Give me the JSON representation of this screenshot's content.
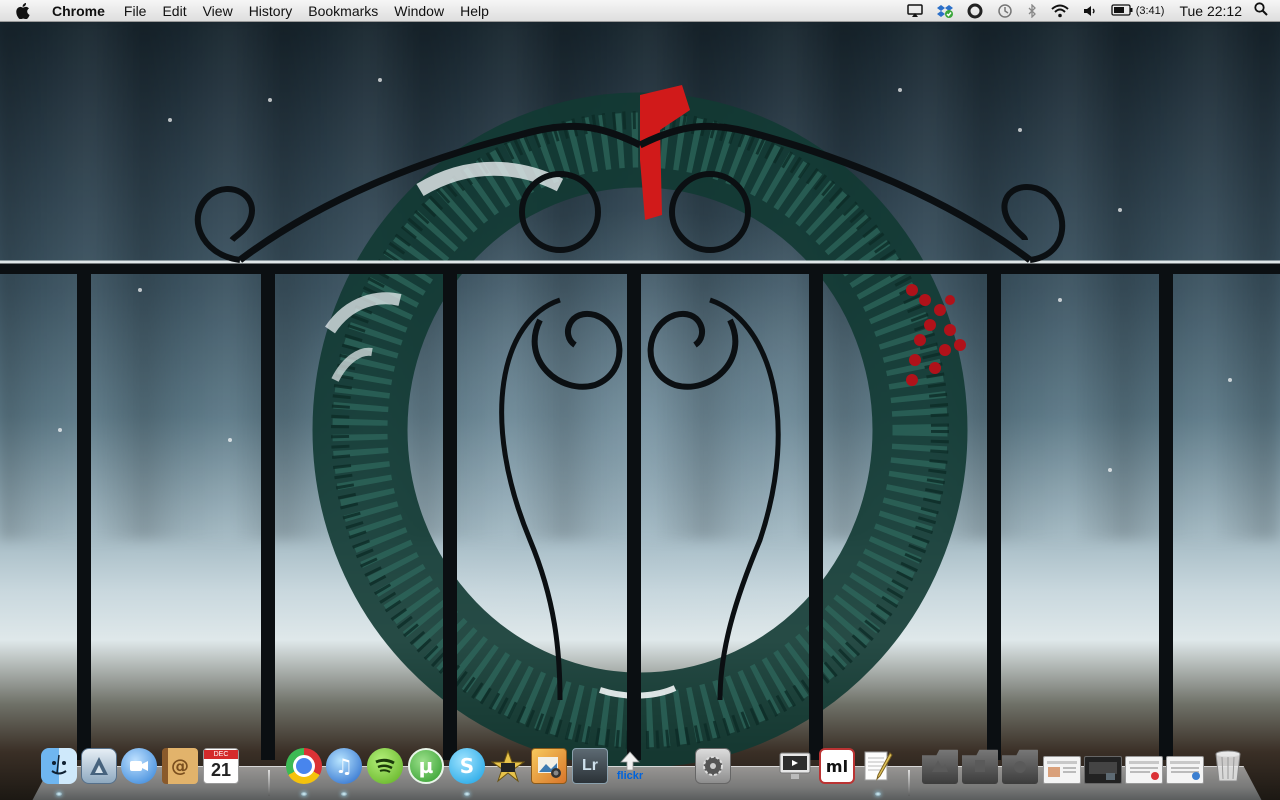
{
  "menubar": {
    "apple_icon": "apple-icon",
    "app_name": "Chrome",
    "menus": [
      "File",
      "Edit",
      "View",
      "History",
      "Bookmarks",
      "Window",
      "Help"
    ],
    "status_icons": [
      "airplay-icon",
      "dropbox-icon",
      "circle-app-icon",
      "time-machine-icon",
      "bluetooth-icon",
      "wifi-icon",
      "volume-icon"
    ],
    "battery": {
      "icon": "battery-icon",
      "text": "(3:41)"
    },
    "clock": "Tue 22:12",
    "search_icon": "spotlight-icon"
  },
  "dock": {
    "apps": [
      {
        "name": "Finder",
        "icon": "finder-icon",
        "running": true
      },
      {
        "name": "Mail",
        "icon": "mail-icon",
        "running": false
      },
      {
        "name": "iChat",
        "icon": "ichat-icon",
        "running": false
      },
      {
        "name": "Address Book",
        "icon": "address-book-icon",
        "running": false
      },
      {
        "name": "iCal",
        "icon": "ical-icon",
        "running": false,
        "label_top": "DEC",
        "label": "21"
      },
      {
        "name": "Chrome",
        "icon": "chrome-icon",
        "running": true
      },
      {
        "name": "iTunes",
        "icon": "itunes-icon",
        "running": true
      },
      {
        "name": "Spotify",
        "icon": "spotify-icon",
        "running": false
      },
      {
        "name": "uTorrent",
        "icon": "utorrent-icon",
        "running": false
      },
      {
        "name": "Skype",
        "icon": "skype-icon",
        "running": true
      },
      {
        "name": "iMovie",
        "icon": "imovie-icon",
        "running": false
      },
      {
        "name": "iPhoto",
        "icon": "iphoto-icon",
        "running": false
      },
      {
        "name": "Lightroom",
        "icon": "lightroom-icon",
        "running": false,
        "label": "Lr"
      },
      {
        "name": "Flickr Uploadr",
        "icon": "flickr-icon",
        "running": false,
        "label": "flickr"
      },
      {
        "name": "System Preferences",
        "icon": "system-preferences-icon",
        "running": false
      },
      {
        "name": "Front Row",
        "icon": "front-row-icon",
        "running": false
      },
      {
        "name": "MarsEdit",
        "icon": "marsedit-icon",
        "running": false,
        "label": "ml"
      },
      {
        "name": "TextEdit",
        "icon": "textedit-icon",
        "running": true
      }
    ],
    "stacks": [
      {
        "name": "Applications",
        "icon": "applications-stack-icon"
      },
      {
        "name": "Documents",
        "icon": "documents-stack-icon"
      },
      {
        "name": "Downloads",
        "icon": "downloads-stack-icon"
      },
      {
        "name": "Minimized window 1",
        "icon": "minimized-window-icon"
      },
      {
        "name": "Minimized window 2",
        "icon": "minimized-window-icon"
      },
      {
        "name": "Minimized window 3",
        "icon": "minimized-window-icon"
      },
      {
        "name": "Minimized window 4",
        "icon": "minimized-window-icon"
      },
      {
        "name": "Trash",
        "icon": "trash-icon"
      }
    ]
  },
  "colors": {
    "menubar_top": "#f6f6f6",
    "menubar_bottom": "#dedede",
    "wreath": "#1d4a42",
    "bow": "#d11a1a",
    "berries": "#b0121a",
    "iron": "#0b0f12"
  }
}
